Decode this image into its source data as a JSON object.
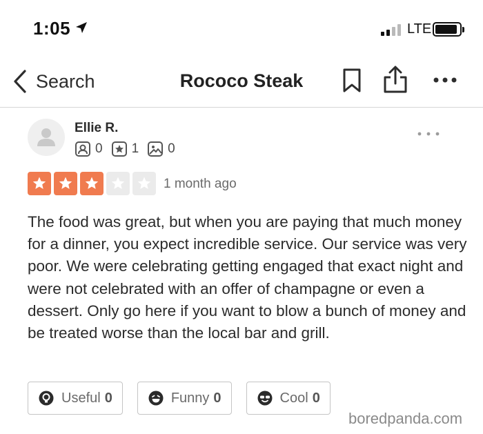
{
  "status_bar": {
    "time": "1:05",
    "network": "LTE",
    "location_icon": "location-arrow-icon",
    "signal_bars_active": 2,
    "signal_bars_total": 4,
    "battery_level": 0.8
  },
  "nav": {
    "back_label": "Search",
    "title": "Rococo Steak",
    "icons": [
      "chevron-left-icon",
      "bookmark-icon",
      "share-icon",
      "more-icon"
    ]
  },
  "review": {
    "author": "Ellie R.",
    "stats": {
      "friends": "0",
      "reviews": "1",
      "photos": "0"
    },
    "rating": 3,
    "rating_max": 5,
    "date": "1 month ago",
    "text": "The food was great, but when you are paying that much money for a dinner, you expect incredible service. Our service was very poor. We were celebrating getting engaged that exact night and were not celebrated with an offer of champagne or even a dessert. Only go here if you want to blow a bunch of money and be treated worse than the local bar and grill."
  },
  "reactions": {
    "useful_label": "Useful",
    "useful_count": "0",
    "funny_label": "Funny",
    "funny_count": "0",
    "cool_label": "Cool",
    "cool_count": "0"
  },
  "watermark": "boredpanda.com",
  "colors": {
    "star_active": "#f07b4f",
    "star_inactive": "#ebebeb",
    "text": "#2b2b2b",
    "muted": "#6a6a6a"
  }
}
